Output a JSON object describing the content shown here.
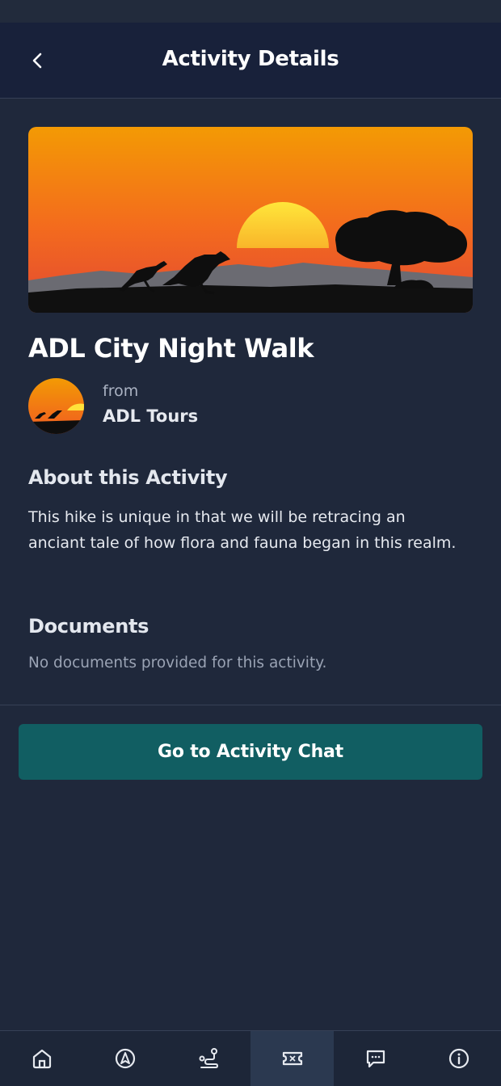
{
  "colors": {
    "background": "#1f283b",
    "header": "#18213a",
    "accent_button": "#115e62",
    "active_tab": "#2b3950"
  },
  "header": {
    "title": "Activity Details",
    "back_icon": "chevron-left-icon"
  },
  "activity": {
    "title": "ADL City Night Walk",
    "hero_image": "sunset-kangaroo-landscape",
    "organizer": {
      "from_label": "from",
      "name": "ADL Tours"
    },
    "about_heading": "About this Activity",
    "about_text": "This hike is unique in that we will be retracing an anciant tale of how flora and fauna began in this realm.",
    "documents_heading": "Documents",
    "documents_empty": "No documents provided for this activity."
  },
  "actions": {
    "chat_button": "Go to Activity Chat"
  },
  "bottom_nav": {
    "items": [
      {
        "icon": "home-icon",
        "active": false
      },
      {
        "icon": "compass-icon",
        "active": false
      },
      {
        "icon": "route-icon",
        "active": false
      },
      {
        "icon": "ticket-icon",
        "active": true
      },
      {
        "icon": "chat-icon",
        "active": false
      },
      {
        "icon": "info-icon",
        "active": false
      }
    ]
  }
}
